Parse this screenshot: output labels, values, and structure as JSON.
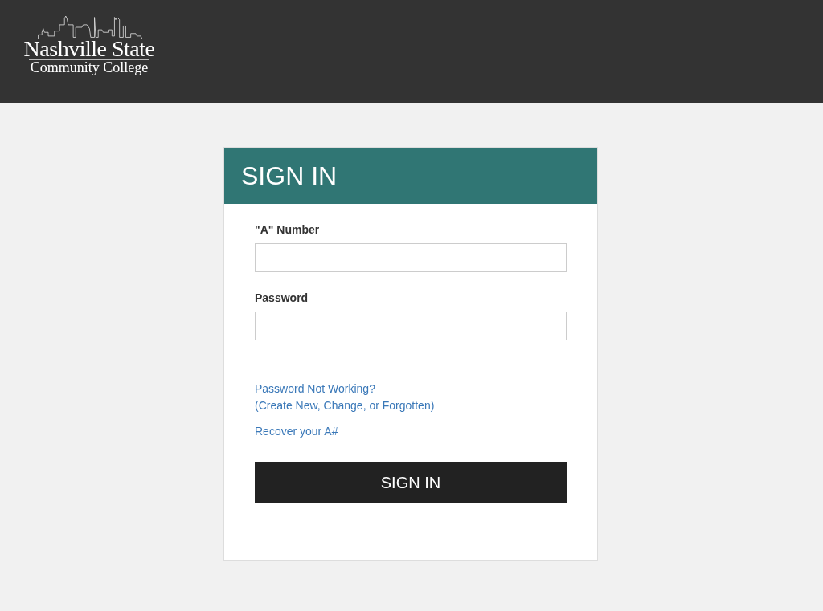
{
  "header": {
    "logo": {
      "title": "Nashville State",
      "subtitle": "Community College"
    }
  },
  "card": {
    "title": "SIGN IN",
    "fields": [
      {
        "label": "\"A\" Number"
      },
      {
        "label": "Password"
      }
    ],
    "links": [
      {
        "lines": [
          "Password Not Working?",
          "(Create New, Change, or Forgotten)"
        ]
      },
      {
        "lines": [
          "Recover your A#"
        ]
      }
    ],
    "button": "SIGN IN"
  }
}
